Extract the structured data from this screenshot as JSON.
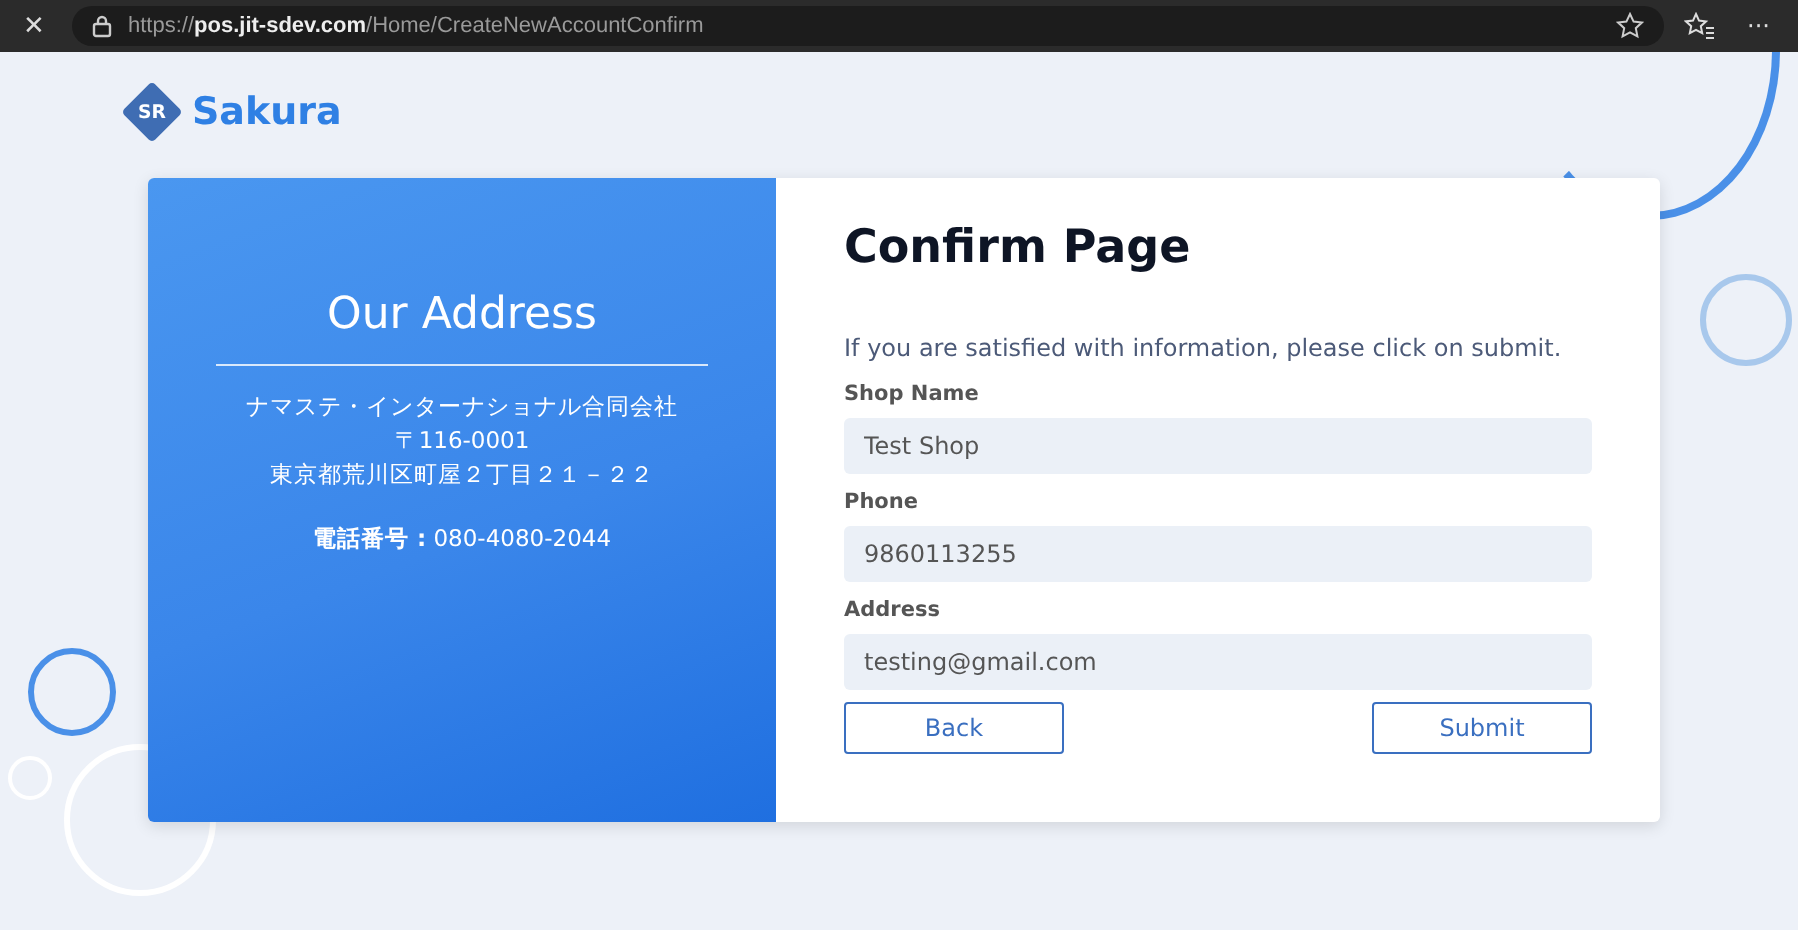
{
  "browser": {
    "close_glyph": "✕",
    "url": "https://**pos.jit-sdev.com**/Home/CreateNewAccountConfirm",
    "more_glyph": "···"
  },
  "logo": {
    "mark": "SR",
    "name": "Sakura"
  },
  "address_panel": {
    "title": "Our Address",
    "lines": [
      "ナマステ・インターナショナル合同会社",
      "〒116-0001",
      "東京都荒川区町屋２丁目２１－２２"
    ],
    "phone": "**電話番号 :** 080-4080-2044"
  },
  "form": {
    "title": "Confirm Page",
    "instruction": "If you are satisfied with information, please click on submit.",
    "fields": [
      {
        "label": "Shop Name",
        "value": "Test Shop"
      },
      {
        "label": "Phone",
        "value": "9860113255"
      },
      {
        "label": "Address",
        "value": "testing@gmail.com"
      }
    ],
    "buttons": [
      "Back",
      "Submit"
    ]
  }
}
